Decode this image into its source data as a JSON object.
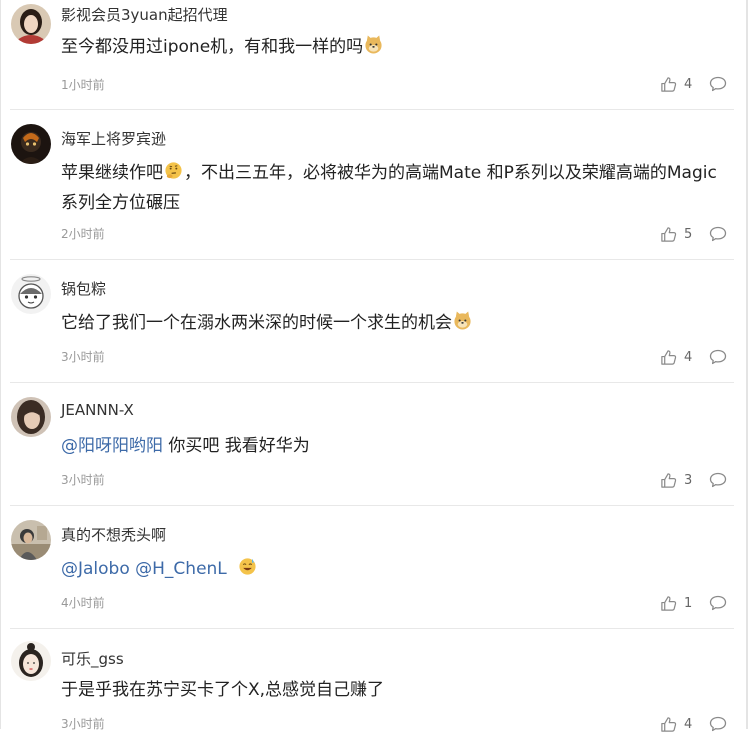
{
  "comments": [
    {
      "username": "影视会员3yuan起招代理",
      "text_parts": [
        "至今都没用过ipone机，有和我一样的吗"
      ],
      "emoji": "doge-emoji",
      "time": "1小时前",
      "likes": "4"
    },
    {
      "username": "海军上将罗宾逊",
      "text_parts": [
        "苹果继续作吧",
        "，不出三五年，必将被华为的高端Mate 和P系列以及荣耀高端的Magic系列全方位碾压"
      ],
      "emoji": "thinking-emoji",
      "time": "2小时前",
      "likes": "5"
    },
    {
      "username": "锅包粽",
      "text_parts": [
        "它给了我们一个在溺水两米深的时候一个求生的机会"
      ],
      "emoji": "doge-emoji",
      "time": "3小时前",
      "likes": "4"
    },
    {
      "username": "JEANNN-X",
      "mention": "@阳呀阳哟阳",
      "text_parts": [
        " 你买吧 我看好华为"
      ],
      "time": "3小时前",
      "likes": "3"
    },
    {
      "username": "真的不想秃头啊",
      "mention": "@Jalobo @H_ChenL",
      "text_parts": [
        " "
      ],
      "emoji": "sweat-smile-emoji",
      "time": "4小时前",
      "likes": "1"
    },
    {
      "username": "可乐_gss",
      "text_parts": [
        "于是乎我在苏宁买卡了个X,总感觉自己赚了"
      ],
      "time": "3小时前",
      "likes": "4"
    }
  ],
  "colors": {
    "mention": "#3d6aa8",
    "time": "#999999",
    "divider": "#e8e8e8",
    "icon": "#8a8a8a"
  },
  "icons": {
    "like": "thumbs-up-icon",
    "reply": "speech-bubble-icon"
  }
}
